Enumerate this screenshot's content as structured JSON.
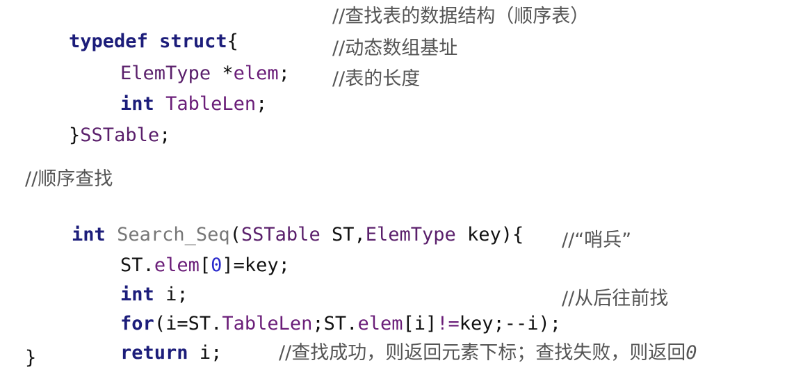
{
  "struct_block": {
    "l1_kw_typedef": "typedef",
    "l1_kw_struct": "struct",
    "l1_brace": "{",
    "l1_comment": "//查找表的数据结构（顺序表）",
    "l2_type": "ElemType",
    "l2_ptr": " *",
    "l2_field": "elem",
    "l2_semi": ";",
    "l2_comment": "//动态数组基址",
    "l3_kw_int": "int",
    "l3_field": "TableLen",
    "l3_semi": ";",
    "l3_comment": "//表的长度",
    "l4_close": "}",
    "l4_name": "SSTable",
    "l4_semi": ";"
  },
  "func_block": {
    "header_comment": "//顺序查找",
    "sig_kw_int": "int",
    "sig_func": "Search_Seq",
    "sig_paren_open": "(",
    "sig_type1": "SSTable",
    "sig_param1": " ST,",
    "sig_type2": "ElemType",
    "sig_param2": " key){",
    "b1_st": "ST.",
    "b1_field": "elem",
    "b1_br_open": "[",
    "b1_num": "0",
    "b1_rest": "]=key;",
    "b1_comment": "//“哨兵”",
    "b2_kw_int": "int",
    "b2_var": " i;",
    "b3_kw_for": "for",
    "b3_p1": "(i=ST.",
    "b3_field1": "TableLen",
    "b3_p2": ";ST.",
    "b3_field2": "elem",
    "b3_p3": "[i]",
    "b3_op": "!=",
    "b3_p4": "key;--i);",
    "b3_comment": "//从后往前找",
    "b4_kw_return": "return",
    "b4_var": " i;",
    "b4_comment_a": "//查找成功，则返回元素下标；查找失败，则返回",
    "b4_comment_b": "0",
    "close_brace": "}"
  }
}
